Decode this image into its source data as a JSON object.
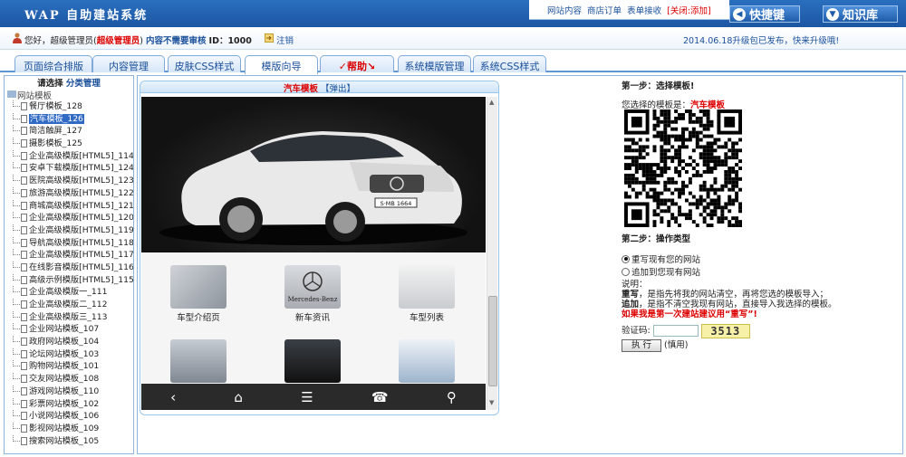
{
  "header": {
    "logo": "WAP 自助建站系统",
    "toplinks": [
      "网站内容",
      "商店订单",
      "表单接收"
    ],
    "close_add": "[关闭:添加]",
    "quick_key": "快捷键",
    "knowledge_base": "知识库"
  },
  "userbar": {
    "greeting": "您好，超级管理员(",
    "role": "超级管理员",
    "audit": "内容不需要审核",
    "close_paren": ")",
    "id_label": "ID：1000",
    "logout": "注销",
    "notice": "2014.06.18升级包已发布，快来升级哦!"
  },
  "tabs": [
    {
      "label": "页面综合排版"
    },
    {
      "label": "内容管理"
    },
    {
      "label": "皮肤CSS样式"
    },
    {
      "label": "模版向导"
    },
    {
      "label": "✓帮助↘"
    },
    {
      "label": "系统模版管理"
    },
    {
      "label": "系统CSS样式"
    }
  ],
  "sidebar": {
    "choose": "请选择",
    "category": "分类管理",
    "root": "网站模板",
    "items": [
      "餐厅模板_128",
      "汽车模板_126",
      "简洁触屏_127",
      "摄影模板_125",
      "企业高级模版[HTML5]_114",
      "安卓下载模版[HTML5]_124",
      "医院高级模版[HTML5]_123",
      "旅游高级模版[HTML5]_122",
      "商城高级模版[HTML5]_121",
      "企业高级模版[HTML5]_120",
      "企业高级模版[HTML5]_119",
      "导航高级模版[HTML5]_118",
      "企业高级模版[HTML5]_117",
      "在线影音模版[HTML5]_116",
      "高级示例模版[HTML5]_115",
      "企业高级模版一_111",
      "企业高级模版二_112",
      "企业高级模版三_113",
      "企业网站模板_107",
      "政府网站模板_104",
      "论坛网站模板_103",
      "购物网站模板_101",
      "交友网站模板_108",
      "游戏网站模板_110",
      "彩票网站模板_102",
      "小说网站模板_106",
      "影视网站模板_109",
      "搜索网站模板_105"
    ]
  },
  "preview": {
    "title": "汽车模板",
    "popout": "【弹出】",
    "plate": "S·MB 1664",
    "grid_labels": [
      "车型介绍页",
      "新车资讯",
      "车型列表"
    ],
    "brand_text": "Mercedes-Benz"
  },
  "right": {
    "step1": "第一步：选择模板!",
    "selected_prefix": "您选择的模板是：",
    "selected_name": "汽车模板",
    "step2": "第二步：操作类型",
    "opt_overwrite": "重写现有您的网站",
    "opt_append": "追加到您现有网站",
    "explain": "说明：",
    "overwrite_word": "重写",
    "overwrite_desc": "，是指先将我的网站清空，再将您选的模板导入；",
    "append_word": "追加",
    "append_desc": "，是指不清空我现有网站，直接导入我选择的模板。",
    "warning": "如果我是第一次建站建议用“重写”!",
    "captcha_label": "验证码:",
    "captcha_value": "3513",
    "exec": "执 行",
    "exec_note": "(慎用)"
  },
  "colors": {
    "brand_blue": "#1c56a2",
    "link_blue": "#1a4f9a",
    "alert_red": "#dd0000"
  }
}
